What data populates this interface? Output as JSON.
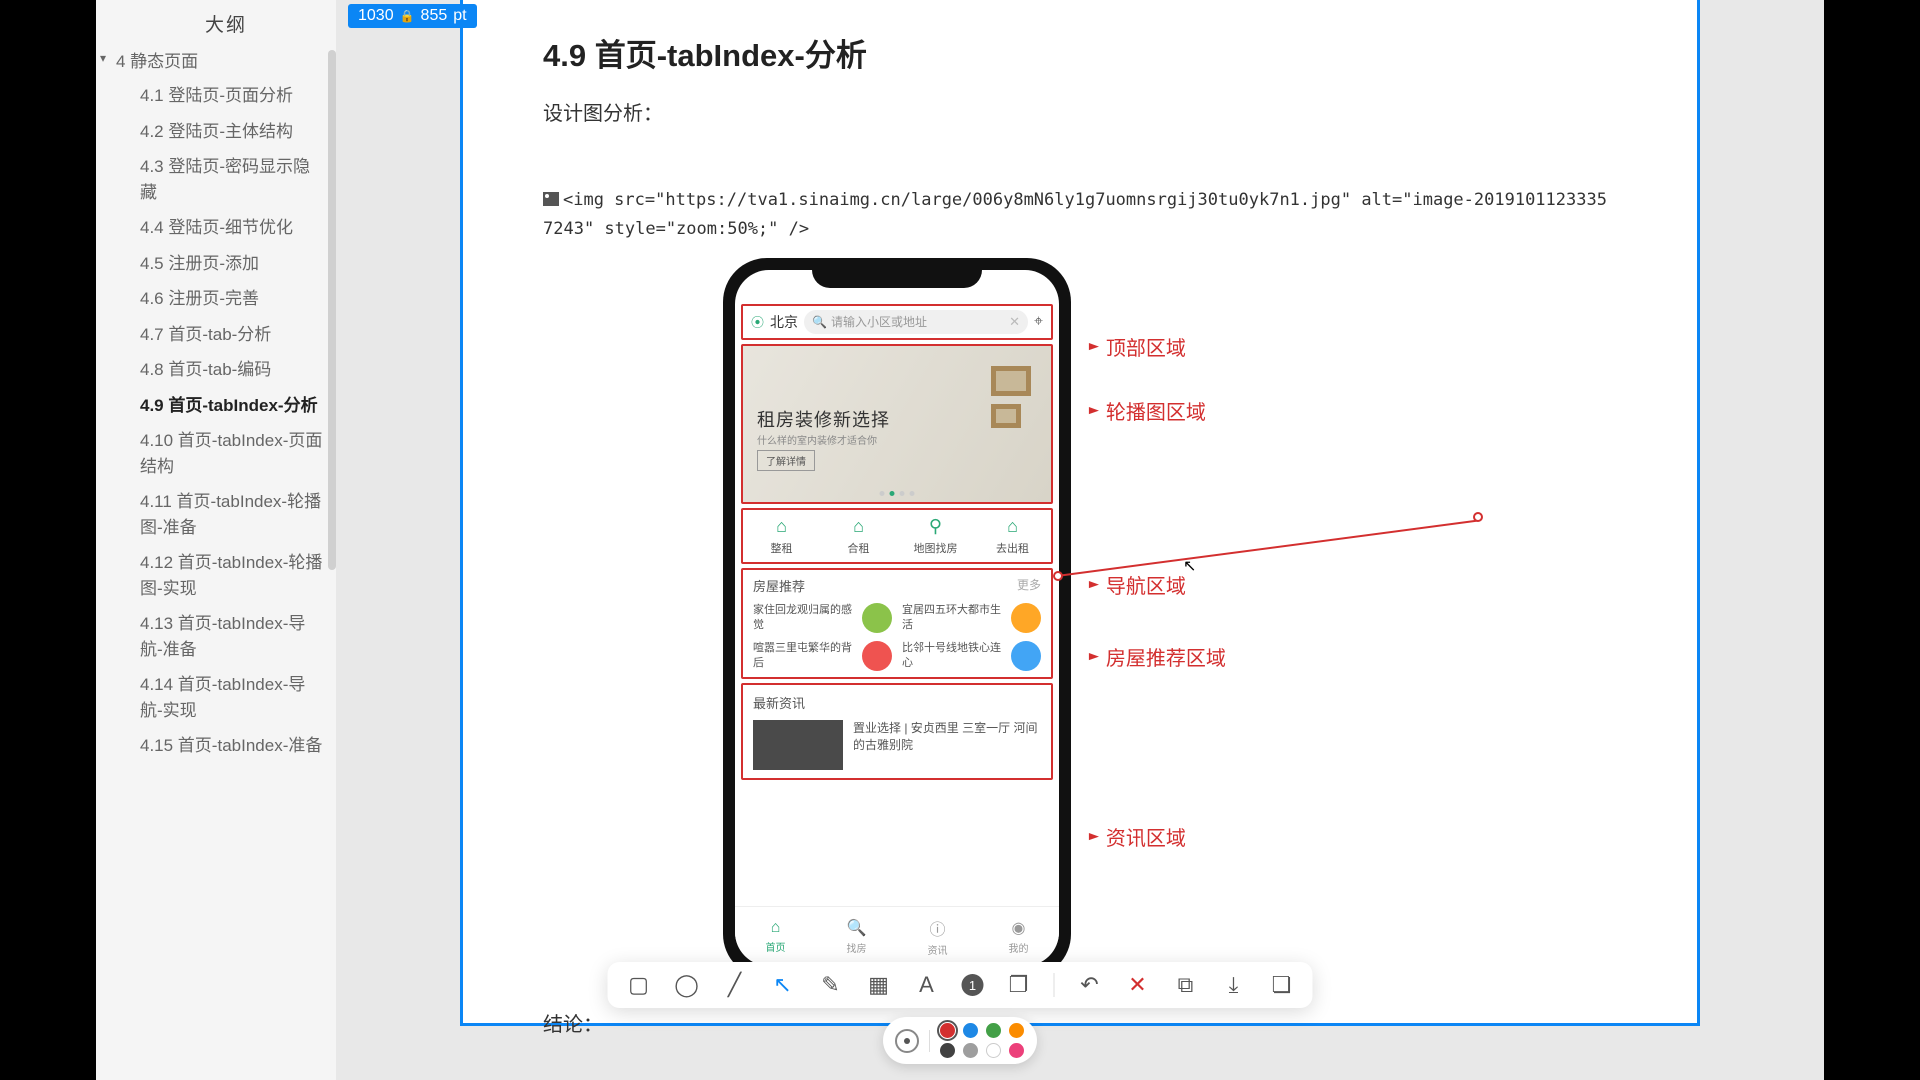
{
  "badge": {
    "width": "1030",
    "height": "855",
    "unit": "pt"
  },
  "sidebar": {
    "title": "大纲",
    "section": "4 静态页面",
    "items": [
      "4.1 登陆页-页面分析",
      "4.2 登陆页-主体结构",
      "4.3 登陆页-密码显示隐藏",
      "4.4 登陆页-细节优化",
      "4.5 注册页-添加",
      "4.6 注册页-完善",
      "4.7 首页-tab-分析",
      "4.8 首页-tab-编码",
      "4.9 首页-tabIndex-分析",
      "4.10 首页-tabIndex-页面结构",
      "4.11 首页-tabIndex-轮播图-准备",
      "4.12 首页-tabIndex-轮播图-实现",
      "4.13 首页-tabIndex-导航-准备",
      "4.14 首页-tabIndex-导航-实现",
      "4.15 首页-tabIndex-准备"
    ],
    "activeIndex": 8
  },
  "doc": {
    "heading": "4.9 首页-tabIndex-分析",
    "subtitle": "设计图分析：",
    "code": "<img src=\"https://tva1.sinaimg.cn/large/006y8mN6ly1g7uomnsrgij30tu0yk7n1.jpg\" alt=\"image-20191011233357243\" style=\"zoom:50%;\" />",
    "conclusion": "结论："
  },
  "annotations": {
    "top": "顶部区域",
    "carousel": "轮播图区域",
    "nav": "导航区域",
    "rec": "房屋推荐区域",
    "news": "资讯区域"
  },
  "mock": {
    "city": "北京",
    "search_ph": "请输入小区或地址",
    "banner_title": "租房装修新选择",
    "banner_sub": "什么样的室内装修才适合你",
    "banner_btn": "了解详情",
    "nav": [
      "整租",
      "合租",
      "地图找房",
      "去出租"
    ],
    "rec_title": "房屋推荐",
    "rec_more": "更多",
    "rec_items": [
      "家住回龙观归属的感觉",
      "宜居四五环大都市生活",
      "喧嚣三里屯繁华的背后",
      "比邻十号线地铁心连心"
    ],
    "news_title": "最新资讯",
    "news_item": "置业选择 | 安贞西里 三室一厅 河间的古雅别院",
    "tabs": [
      "首页",
      "找房",
      "资讯",
      "我的"
    ]
  },
  "toolbar": {
    "num": "1"
  },
  "palette": [
    "#d32f2f",
    "#1e88e5",
    "#43a047",
    "#fb8c00",
    "#424242",
    "#9e9e9e",
    "#ffffff",
    "#ec407a"
  ]
}
